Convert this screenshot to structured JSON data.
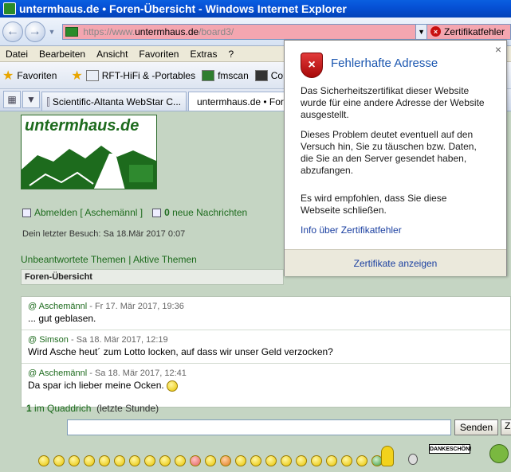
{
  "window": {
    "title": "untermhaus.de • Foren-Übersicht - Windows Internet Explorer"
  },
  "address": {
    "scheme": "https://www.",
    "host": "untermhaus.de",
    "path": "/board3/",
    "cert_label": "Zertifikatfehler"
  },
  "menu": [
    "Datei",
    "Bearbeiten",
    "Ansicht",
    "Favoriten",
    "Extras",
    "?"
  ],
  "favorites": {
    "label": "Favoriten",
    "items": [
      "RFT-HiFi & -Portables",
      "fmscan",
      "Comag"
    ]
  },
  "tabs": [
    "Scientific-Altanta WebStar C...",
    "untermhaus.de • Foren..."
  ],
  "page": {
    "logo_text": "untermhaus.de",
    "logout_text": "Abmelden [ Aschemännl ]",
    "new_messages_count": "0",
    "new_messages_label": "neue Nachrichten",
    "last_visit": "Dein letzter Besuch: Sa 18.Mär 2017 0:07",
    "unanswered": "Unbeantwortete Themen",
    "separator": "|",
    "active": "Aktive Themen",
    "forum_overview": "Foren-Übersicht"
  },
  "posts": [
    {
      "prefix": "@",
      "author": "Aschemännl",
      "date": "- Fr 17. Mär 2017, 19:36",
      "text": "... gut geblasen."
    },
    {
      "prefix": "@",
      "author": "Simson",
      "date": "- Sa 18. Mär 2017, 12:19",
      "text": "Wird Asche heut´ zum Lotto locken, auf dass wir unser Geld verzocken?"
    },
    {
      "prefix": "@",
      "author": "Aschemännl",
      "date": "- Sa 18. Mär 2017, 12:41",
      "text": "Da spar ich lieber meine Ocken."
    }
  ],
  "chat": {
    "online_count": "1",
    "online_label": "im Quaddrich",
    "online_period": "(letzte Stunde)",
    "send_label": "Senden",
    "z_label": "Z",
    "danke_label": "DANKESCHÖN!"
  },
  "popup": {
    "title": "Fehlerhafte Adresse",
    "para1": "Das Sicherheitszertifikat dieser Website wurde für eine andere Adresse der Website ausgestellt.",
    "para2": "Dieses Problem deutet eventuell auf den Versuch hin, Sie zu täuschen bzw. Daten, die Sie an den Server gesendet haben, abzufangen.",
    "para3": "Es wird empfohlen, dass Sie diese Webseite schließen.",
    "info_link": "Info über Zertifikatfehler",
    "view_certs": "Zertifikate anzeigen"
  }
}
